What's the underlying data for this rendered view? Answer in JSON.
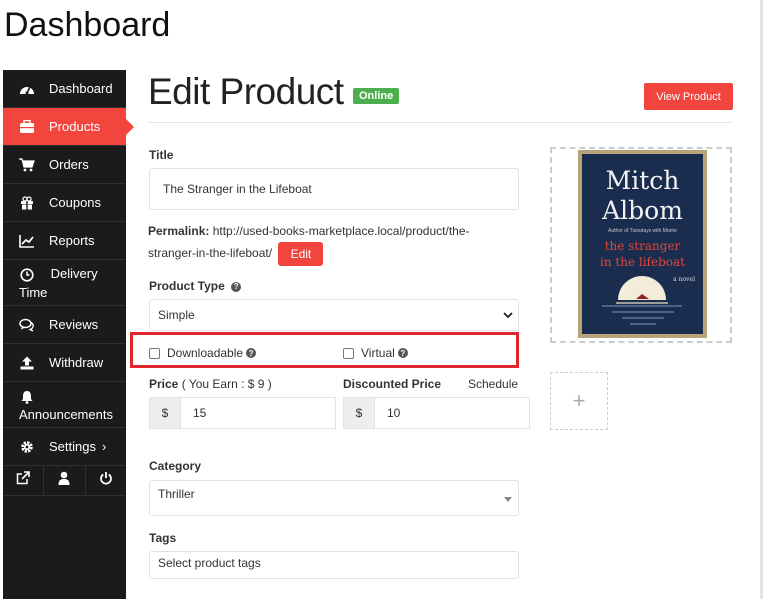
{
  "page": {
    "heading": "Dashboard"
  },
  "sidebar": {
    "items": [
      {
        "label": "Dashboard",
        "icon": "speedometer-icon"
      },
      {
        "label": "Products",
        "icon": "briefcase-icon",
        "active": true
      },
      {
        "label": "Orders",
        "icon": "cart-icon"
      },
      {
        "label": "Coupons",
        "icon": "gift-icon"
      },
      {
        "label": "Reports",
        "icon": "line-chart-icon"
      },
      {
        "label": "Delivery",
        "label2": "Time",
        "icon": "clock-icon"
      },
      {
        "label": "Reviews",
        "icon": "comments-icon"
      },
      {
        "label": "Withdraw",
        "icon": "upload-icon"
      },
      {
        "label": "Announcements",
        "icon": "bell-icon"
      },
      {
        "label": "Settings",
        "icon": "gear-icon",
        "chevron": "›"
      }
    ],
    "bottom_icons": [
      "external-link-icon",
      "user-icon",
      "power-icon"
    ]
  },
  "main": {
    "title": "Edit Product",
    "status": "Online",
    "view_button": "View Product",
    "title_label": "Title",
    "title_value": "The Stranger in the Lifeboat",
    "permalink_label": "Permalink:",
    "permalink_url": "http://used-books-marketplace.local/product/the-stranger-in-the-lifeboat/",
    "permalink_edit": "Edit",
    "product_type_label": "Product Type",
    "product_type_value": "Simple",
    "downloadable_label": "Downloadable",
    "virtual_label": "Virtual",
    "price_label": "Price",
    "price_earn": "( You Earn : $ 9 )",
    "discounted_label": "Discounted Price",
    "schedule_label": "Schedule",
    "currency": "$",
    "price_value": "15",
    "discounted_value": "10",
    "category_label": "Category",
    "category_value": "Thriller",
    "tags_label": "Tags",
    "tags_placeholder": "Select product tags",
    "help_glyph": "?",
    "add_image_glyph": "+"
  },
  "book_cover": {
    "author_line1": "Mitch",
    "author_line2": "Albom",
    "author_credit": "Author of Tuesdays with Morrie",
    "title_line1": "the stranger",
    "title_line2": "in the lifeboat",
    "subtitle": "a novel"
  },
  "colors": {
    "accent": "#f1453d",
    "online": "#4cae4c",
    "sidebar_bg": "#1b1b1b",
    "highlight": "#e1262d"
  }
}
